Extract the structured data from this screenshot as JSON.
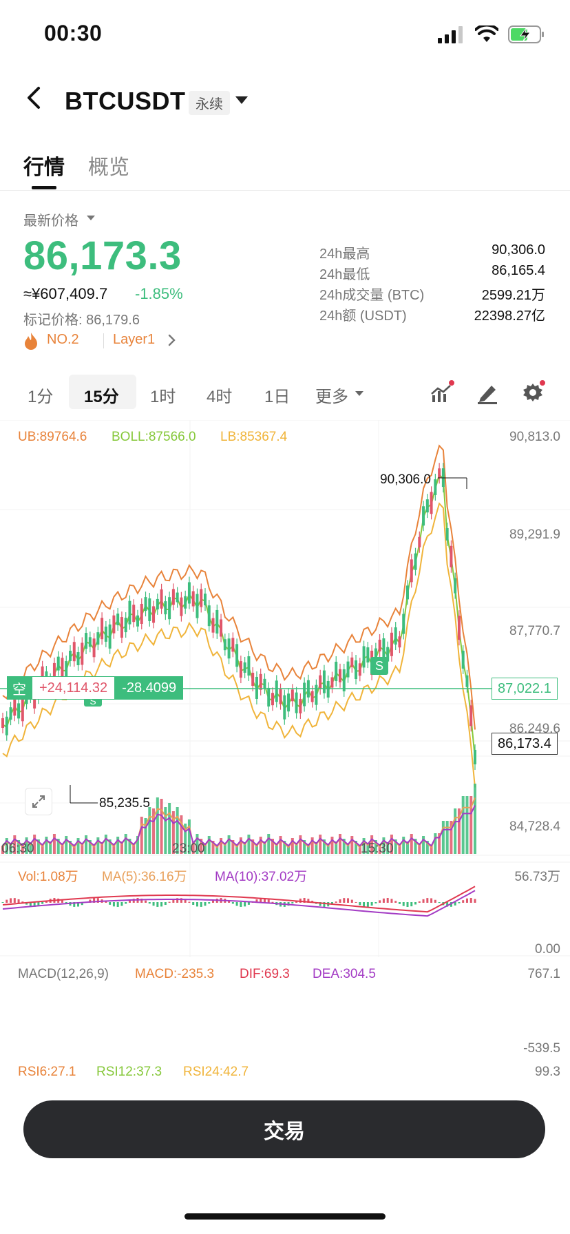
{
  "status": {
    "time": "00:30"
  },
  "header": {
    "symbol": "BTCUSDT",
    "contract_type": "永续"
  },
  "tabs": [
    {
      "label": "行情",
      "active": true
    },
    {
      "label": "概览",
      "active": false
    }
  ],
  "price": {
    "latest_label": "最新价格",
    "last": "86,173.3",
    "cny": "≈¥607,409.7",
    "change": "-1.85%",
    "mark_label": "标记价格: 86,179.6",
    "rank": "NO.2",
    "tag": "Layer1",
    "colors": {
      "down": "#3dbd7d",
      "up": "#e0566a"
    }
  },
  "stats": [
    {
      "key": "24h最高",
      "value": "90,306.0"
    },
    {
      "key": "24h最低",
      "value": "86,165.4"
    },
    {
      "key": "24h成交量 (BTC)",
      "value": "2599.21万"
    },
    {
      "key": "24h额 (USDT)",
      "value": "22398.27亿"
    }
  ],
  "intervals": [
    {
      "label": "1分",
      "active": false
    },
    {
      "label": "15分",
      "active": true
    },
    {
      "label": "1时",
      "active": false
    },
    {
      "label": "4时",
      "active": false
    },
    {
      "label": "1日",
      "active": false
    },
    {
      "label": "更多",
      "active": false
    }
  ],
  "chart": {
    "boll": {
      "ub": "UB:89764.6",
      "boll": "BOLL:87566.0",
      "lb": "LB:85367.4"
    },
    "price_axis": [
      "90,813.0",
      "89,291.9",
      "87,770.7",
      "86,249.6",
      "84,728.4"
    ],
    "time_axis": [
      "06:30",
      "23:00",
      "15:30"
    ],
    "high_label": "90,306.0",
    "low_label": "85,235.5",
    "marker_s": "S",
    "marker_s2": "S",
    "position": {
      "side": "空",
      "pnl": "+24,114.32",
      "roe": "-28.4099"
    },
    "entry_price": "87,022.1",
    "last_price_tag": "86,173.4",
    "vol": {
      "vol": "Vol:1.08万",
      "ma5": "MA(5):36.16万",
      "ma10": "MA(10):37.02万",
      "axis": [
        "56.73万",
        "0.00"
      ]
    },
    "macd": {
      "name": "MACD(12,26,9)",
      "macd": "MACD:-235.3",
      "dif": "DIF:69.3",
      "dea": "DEA:304.5",
      "axis": [
        "767.1",
        "-539.5"
      ]
    },
    "rsi": {
      "rsi6": "RSI6:27.1",
      "rsi12": "RSI12:37.3",
      "rsi24": "RSI24:42.7",
      "axis": [
        "99.3"
      ]
    }
  },
  "trade_button": "交易"
}
